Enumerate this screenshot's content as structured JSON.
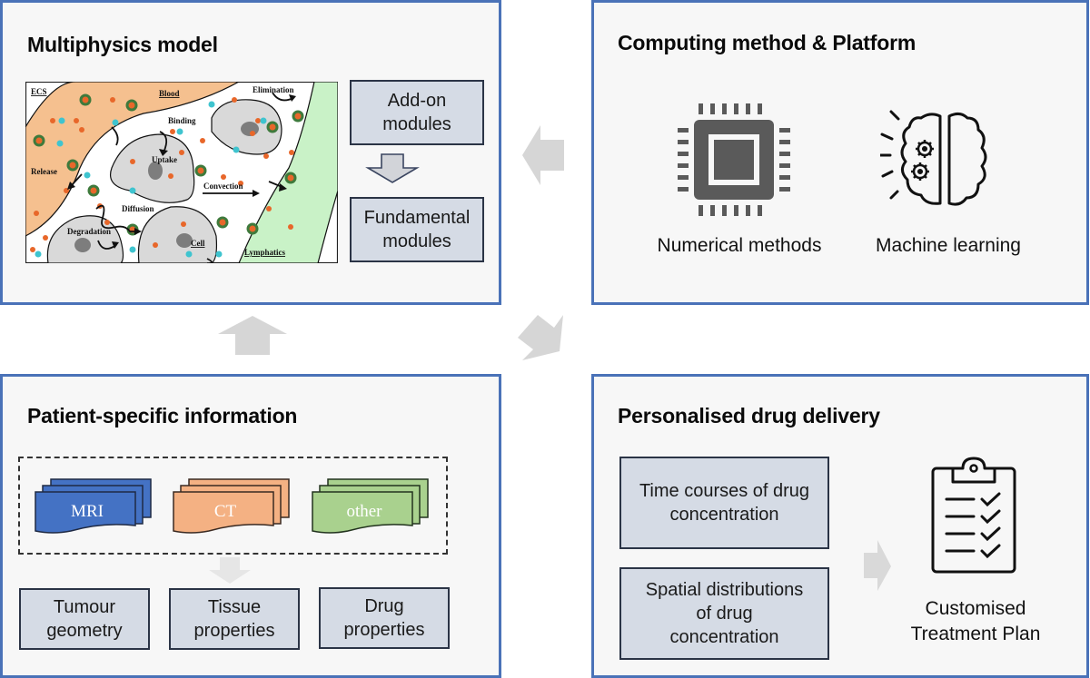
{
  "panels": {
    "multiphysics": {
      "title": "Multiphysics model",
      "illustration": {
        "labels": {
          "ecs": "ECS",
          "blood": "Blood",
          "elimination": "Elimination",
          "binding": "Binding",
          "uptake": "Uptake",
          "release": "Release",
          "convection": "Convection",
          "diffusion": "Diffusion",
          "degradation": "Degradation",
          "cell": "Cell",
          "lymphatics": "Lymphatics"
        },
        "colors": {
          "blood": "#f5c08f",
          "lymphatics": "#c9f2c7",
          "cell": "#d9d9d9",
          "nucleus": "#7d7d7d",
          "orange_particle": "#e8672a",
          "cyan_particle": "#3fc4cf",
          "green_ring": "#3e7a3c"
        }
      },
      "modules": {
        "addon": "Add-on modules",
        "fundamental": "Fundamental modules"
      }
    },
    "computing": {
      "title": "Computing method & Platform",
      "items": [
        {
          "icon": "cpu-chip-icon",
          "label": "Numerical methods"
        },
        {
          "icon": "brain-gears-icon",
          "label": "Machine learning"
        }
      ]
    },
    "patient": {
      "title": "Patient-specific information",
      "imaging": [
        {
          "label": "MRI",
          "color": "#4472c4"
        },
        {
          "label": "CT",
          "color": "#f4b183"
        },
        {
          "label": "other",
          "color": "#a9d18e"
        }
      ],
      "properties": [
        {
          "line1": "Tumour",
          "line2": "geometry"
        },
        {
          "line1": "Tissue",
          "line2": "properties"
        },
        {
          "line1": "Drug",
          "line2": "properties"
        }
      ]
    },
    "delivery": {
      "title": "Personalised drug delivery",
      "outputs": [
        {
          "line1": "Time courses of drug",
          "line2": "concentration"
        },
        {
          "line1": "Spatial distributions",
          "line2": "of drug",
          "line3": "concentration"
        }
      ],
      "plan": {
        "line1": "Customised",
        "line2": "Treatment Plan",
        "icon": "clipboard-checklist-icon"
      }
    }
  },
  "colors": {
    "panel_border": "#4a72b8",
    "panel_bg": "#f7f7f7",
    "module_bg": "#d5dbe5",
    "flow_arrow": "#d6d6d6"
  }
}
